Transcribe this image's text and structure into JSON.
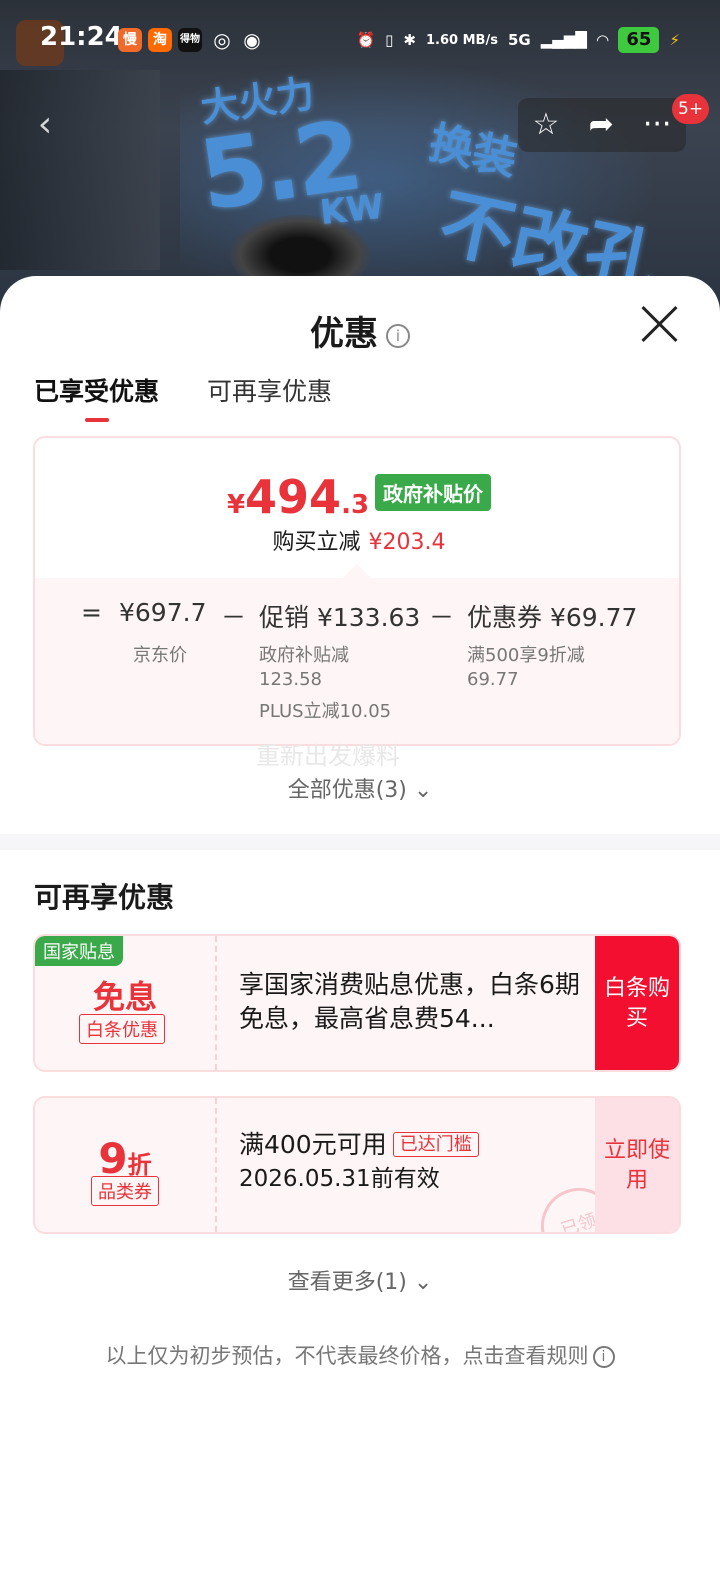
{
  "status_bar": {
    "time": "21:24",
    "app_icons": [
      "慢",
      "淘",
      "得物"
    ],
    "net_speed": "1.60 MB/s",
    "network": "5G",
    "battery": "65"
  },
  "hero_image": {
    "texts": [
      "大火力",
      "5.2",
      "KW",
      "换装",
      "不改孔"
    ]
  },
  "top_nav": {
    "badge": "5+"
  },
  "sheet": {
    "title": "优惠",
    "tabs": [
      {
        "label": "已享受优惠",
        "active": true
      },
      {
        "label": "可再享优惠",
        "active": false
      }
    ],
    "summary": {
      "currency": "¥",
      "price_int": "494",
      "price_dec": ".3",
      "gov_tag": "政府补贴价",
      "reduce_label": "购买立减",
      "reduce_value": "¥203.4",
      "eq": "=",
      "minus": "－",
      "jd_price": "¥697.7",
      "jd_price_label": "京东价",
      "promo": "促销 ¥133.63",
      "promo_sub1": "政府补贴减",
      "promo_sub2": "123.58",
      "promo_sub3": "PLUS立减10.05",
      "coupon": "优惠券 ¥69.77",
      "coupon_sub1": "满500享9折减",
      "coupon_sub2": "69.77"
    },
    "watermark": "重新出发爆料",
    "all_deals": "全部优惠(3) ⌄",
    "section_title": "可再享优惠",
    "coupons": [
      {
        "corner_tag": "国家贴息",
        "big_label": "免息",
        "small_tag": "白条优惠",
        "desc": "享国家消费贴息优惠，白条6期免息，最高省息费54...",
        "action": "白条购买"
      },
      {
        "big_label_num": "9",
        "big_label_unit": "折",
        "small_tag": "品类券",
        "desc_line1": "满400元可用",
        "threshold_tag": "已达门槛",
        "desc_line2": "2026.05.31前有效",
        "action": "立即使用",
        "stamp": "已领"
      }
    ],
    "see_more": "查看更多(1) ⌄",
    "disclaimer": "以上仅为初步预估，不代表最终价格，点击查看规则"
  }
}
